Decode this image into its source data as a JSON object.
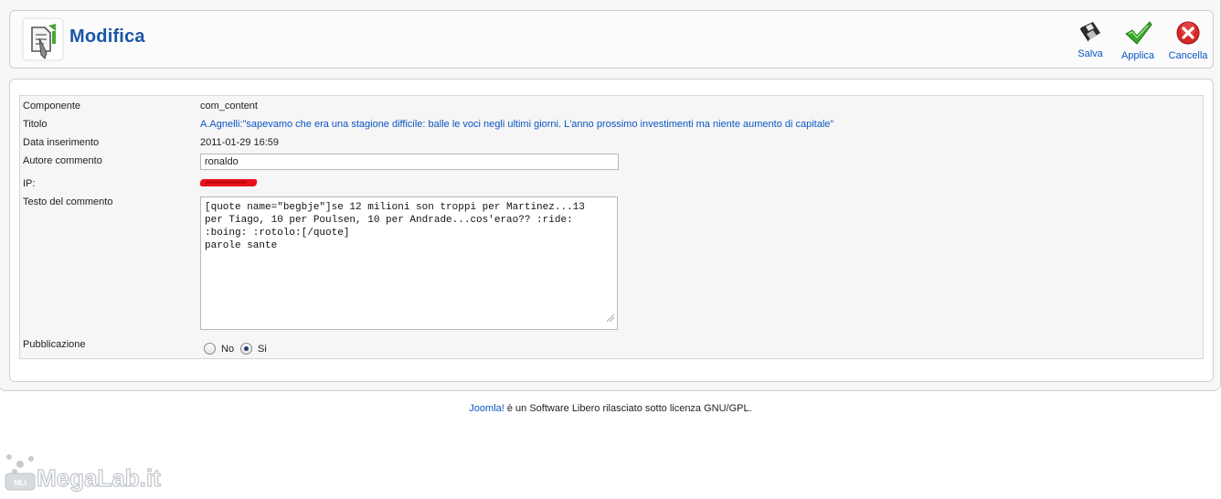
{
  "header": {
    "title": "Modifica",
    "buttons": {
      "save_label": "Salva",
      "apply_label": "Applica",
      "cancel_label": "Cancella"
    }
  },
  "form": {
    "componente_label": "Componente",
    "componente_value": "com_content",
    "titolo_label": "Titolo",
    "titolo_value": "A.Agnelli:\"sapevamo che era una stagione difficile: balle le voci negli ultimi giorni. L'anno prossimo investimenti ma niente aumento di capitale\"",
    "data_label": "Data inserimento",
    "data_value": "2011-01-29 16:59",
    "autore_label": "Autore commento",
    "autore_value": "ronaldo",
    "ip_label": "IP:",
    "testo_label": "Testo del commento",
    "testo_value": "[quote name=\"begbje\"]se 12 milioni son troppi per Martinez...13\nper Tiago, 10 per Poulsen, 10 per Andrade...cos'erao?? :ride:\n:boing: :rotolo:[/quote]\nparole sante",
    "pubblicazione_label": "Pubblicazione",
    "pubblicazione_options": [
      "No",
      "Si"
    ],
    "pubblicazione_selected": "Si"
  },
  "footer": {
    "link_text": "Joomla!",
    "text": " è un Software Libero rilasciato sotto licenza GNU/GPL."
  },
  "watermark": {
    "text": "MegaLab.it",
    "badge": "MLI"
  },
  "colors": {
    "accent": "#1a56a8",
    "link": "#0b55c4",
    "apply_green": "#3aa52c",
    "cancel_red": "#d62828"
  }
}
